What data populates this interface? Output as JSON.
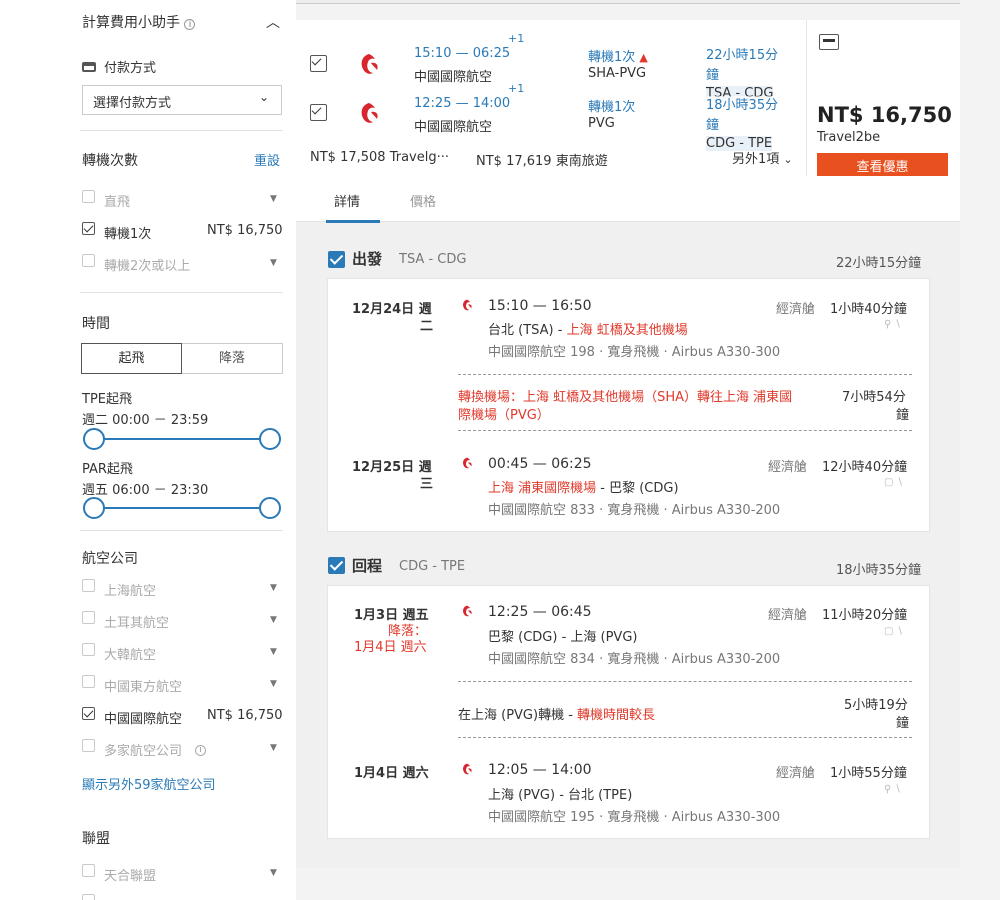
{
  "sidebar": {
    "calc_title": "計算費用小助手",
    "payment_label": "付款方式",
    "payment_select": "選擇付款方式",
    "stops_title": "轉機次數",
    "stops_reset": "重設",
    "stops": [
      {
        "label": "直飛",
        "checked": false,
        "price": ""
      },
      {
        "label": "轉機1次",
        "checked": true,
        "price": "NT$ 16,750"
      },
      {
        "label": "轉機2次或以上",
        "checked": false,
        "price": ""
      }
    ],
    "time_title": "時間",
    "time_tabs": [
      "起飛",
      "降落"
    ],
    "tpe_title": "TPE起飛",
    "tpe_range": "週二 00:00 － 23:59",
    "par_title": "PAR起飛",
    "par_range": "週五 06:00 － 23:30",
    "airlines_title": "航空公司",
    "airlines": [
      {
        "label": "上海航空",
        "checked": false,
        "price": ""
      },
      {
        "label": "土耳其航空",
        "checked": false,
        "price": ""
      },
      {
        "label": "大韓航空",
        "checked": false,
        "price": ""
      },
      {
        "label": "中國東方航空",
        "checked": false,
        "price": ""
      },
      {
        "label": "中國國際航空",
        "checked": true,
        "price": "NT$ 16,750"
      },
      {
        "label": "多家航空公司",
        "checked": false,
        "price": ""
      }
    ],
    "show_more": "顯示另外59家航空公司",
    "alliance_title": "聯盟",
    "alliances": [
      {
        "label": "天合聯盟",
        "checked": false
      }
    ]
  },
  "summary": {
    "rows": [
      {
        "times": "15:10 — 06:25",
        "plus": "+1",
        "airline": "中國國際航空",
        "stops": "轉機1次",
        "via": "SHA-PVG",
        "duration": "22小時15分鐘",
        "route": "TSA - CDG"
      },
      {
        "times": "12:25 — 14:00",
        "plus": "+1",
        "airline": "中國國際航空",
        "stops": "轉機1次",
        "via": "PVG",
        "duration": "18小時35分鐘",
        "route": "CDG - TPE"
      }
    ],
    "other_prices": [
      "NT$ 17,508 Travelg···",
      "NT$ 17,619 東南旅遊"
    ],
    "more": "另外1項",
    "price": "NT$ 16,750",
    "provider": "Travel2be",
    "cta": "查看優惠"
  },
  "tabs": [
    "詳情",
    "價格"
  ],
  "outbound": {
    "label": "出發",
    "route": "TSA - CDG",
    "duration": "22小時15分鐘",
    "seg1": {
      "date": "12月24日 週",
      "date2": "二",
      "times": "15:10 — 16:50",
      "from": "台北 (TSA) - ",
      "to": "上海 虹橋及其他機場",
      "flight": "中國國際航空 198 · 寬身飛機 · Airbus A330-300",
      "cabin": "經濟艙",
      "dur": "1小時40分鐘"
    },
    "transfer": {
      "line1": "轉換機場：上海 虹橋及其他機場（SHA）轉往上海 浦東國",
      "line2": "際機場（PVG）",
      "dur1": "7小時54分",
      "dur2": "鐘"
    },
    "seg2": {
      "date": "12月25日 週",
      "date2": "三",
      "times": "00:45 — 06:25",
      "from": "上海 浦東國際機場",
      "to": " - 巴黎 (CDG)",
      "flight": "中國國際航空 833 · 寬身飛機 · Airbus A330-200",
      "cabin": "經濟艙",
      "dur": "12小時40分鐘"
    }
  },
  "inbound": {
    "label": "回程",
    "route": "CDG - TPE",
    "duration": "18小時35分鐘",
    "seg1": {
      "date": "1月3日 週五",
      "land1": "降落：",
      "land2": "1月4日 週六",
      "times": "12:25 — 06:45",
      "fromto": "巴黎 (CDG) - 上海 (PVG)",
      "flight": "中國國際航空 834 · 寬身飛機 · Airbus A330-200",
      "cabin": "經濟艙",
      "dur": "11小時20分鐘"
    },
    "layover": {
      "text": "在上海 (PVG)轉機 - ",
      "warn": "轉機時間較長",
      "dur1": "5小時19分",
      "dur2": "鐘"
    },
    "seg2": {
      "date": "1月4日 週六",
      "times": "12:05 — 14:00",
      "fromto": "上海 (PVG) - 台北 (TPE)",
      "flight": "中國國際航空 195 · 寬身飛機 · Airbus A330-300",
      "cabin": "經濟艙",
      "dur": "1小時55分鐘"
    }
  },
  "colors": {
    "accent": "#2a7ab8",
    "cta": "#e8501f",
    "warn": "#e0392b",
    "logo": "#d8262e"
  }
}
